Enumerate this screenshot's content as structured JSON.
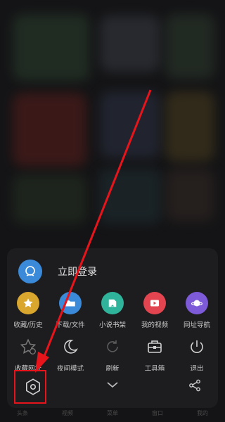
{
  "login": {
    "label": "立即登录"
  },
  "menu_row1": [
    {
      "label": "收藏/历史",
      "icon": "star-icon",
      "color": "#d9a62e"
    },
    {
      "label": "下载/文件",
      "icon": "folder-icon",
      "color": "#3b8ad9"
    },
    {
      "label": "小说书架",
      "icon": "book-icon",
      "color": "#2fb39a"
    },
    {
      "label": "我的视频",
      "icon": "play-icon",
      "color": "#e2454f"
    },
    {
      "label": "网址导航",
      "icon": "planet-icon",
      "color": "#7d5ad8"
    }
  ],
  "menu_row2": [
    {
      "label": "收藏网址",
      "icon": "star-add-icon"
    },
    {
      "label": "夜间模式",
      "icon": "moon-icon"
    },
    {
      "label": "刷新",
      "icon": "refresh-icon"
    },
    {
      "label": "工具箱",
      "icon": "toolbox-icon"
    },
    {
      "label": "退出",
      "icon": "power-icon"
    }
  ],
  "tabbar": [
    {
      "label": "头条"
    },
    {
      "label": "视频"
    },
    {
      "label": "菜单"
    },
    {
      "label": "窗口"
    },
    {
      "label": "我的"
    }
  ],
  "annotation_color": "#e8141c"
}
